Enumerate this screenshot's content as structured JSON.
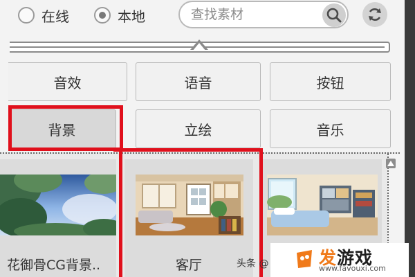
{
  "source": {
    "online_label": "在线",
    "local_label": "本地",
    "selected": "local"
  },
  "search": {
    "placeholder": "查找素材",
    "search_icon": "search-icon",
    "refresh_icon": "refresh-icon"
  },
  "categories": {
    "row1": [
      "音效",
      "语音",
      "按钮"
    ],
    "row2": [
      "背景",
      "立绘",
      "音乐"
    ],
    "active": "背景"
  },
  "assets": [
    {
      "caption": "花御骨CG背景.."
    },
    {
      "caption": "客厅"
    },
    {
      "caption": ""
    }
  ],
  "watermark": {
    "toutiao": "头条 @",
    "brand_fa": "发",
    "brand_rest": "游戏",
    "url": "www.favouxi.com"
  },
  "colors": {
    "highlight": "#e0101c",
    "brand_accent": "#f07a1a"
  }
}
